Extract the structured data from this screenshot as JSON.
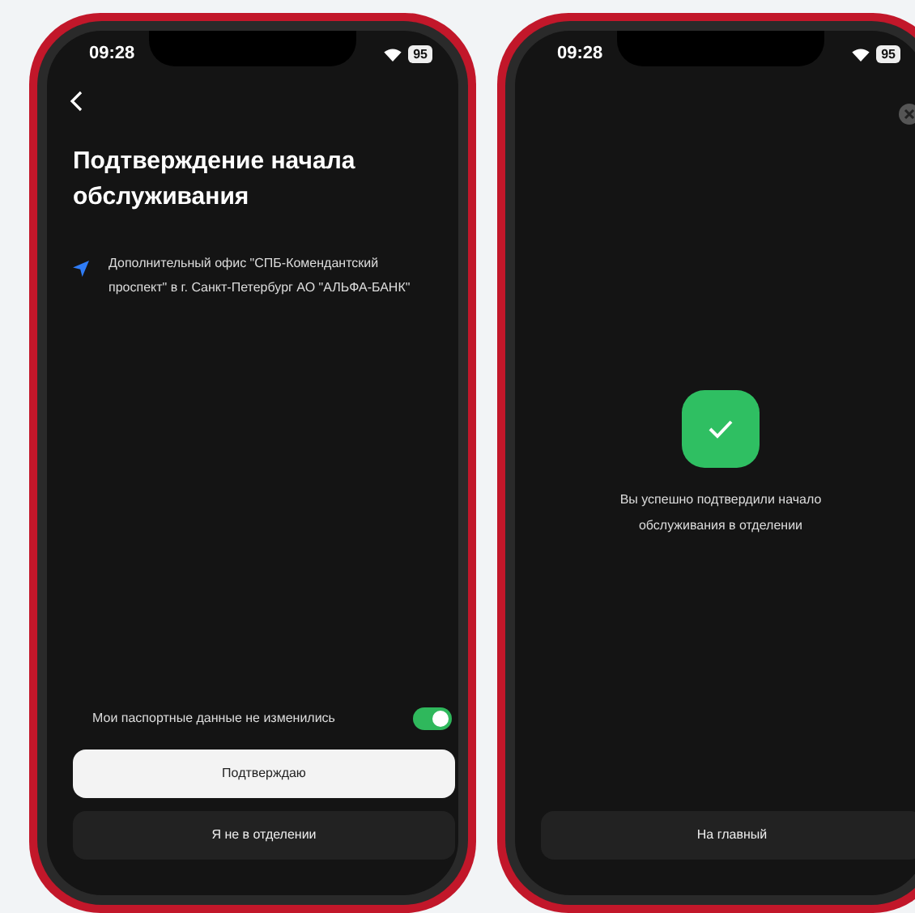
{
  "screens": [
    {
      "kind": "confirm",
      "status": {
        "time": "09:28",
        "battery": "95"
      },
      "title": "Подтверждение начала обслуживания",
      "location": "Дополнительный офис \"СПБ-Комендантский проспект\" в г. Санкт-Петербург АО \"АЛЬФА-БАНК\"",
      "toggle": {
        "label": "Мои паспортные данные не изменились",
        "on": true
      },
      "buttons": [
        {
          "label": "Подтверждаю",
          "kind": "primary"
        },
        {
          "label": "Я не в отделении",
          "kind": "secondary"
        }
      ]
    },
    {
      "kind": "success",
      "status": {
        "time": "09:28",
        "battery": "95"
      },
      "message": "Вы успешно подтвердили начало обслуживания в отделении",
      "buttons": [
        {
          "label": "На главный",
          "kind": "secondary"
        }
      ]
    }
  ]
}
